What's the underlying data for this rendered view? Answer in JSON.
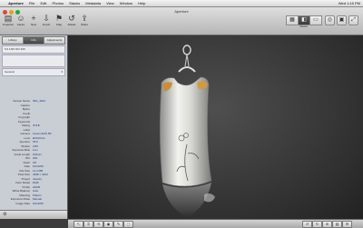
{
  "menubar": {
    "app_name": "Aperture",
    "items": [
      "File",
      "Edit",
      "Photos",
      "Stacks",
      "Metadata",
      "View",
      "Window",
      "Help"
    ],
    "status": [
      "Wed 1:15 PM"
    ]
  },
  "window": {
    "title": "Aperture"
  },
  "toolbar": {
    "buttons": [
      {
        "icon": "inbox-icon",
        "glyph": "▤",
        "label": "Inspector"
      },
      {
        "icon": "person-icon",
        "glyph": "☺",
        "label": "Faces"
      },
      {
        "icon": "plus-icon",
        "glyph": "+",
        "label": "New"
      },
      {
        "icon": "import-icon",
        "glyph": "⇩",
        "label": "Import"
      },
      {
        "icon": "flag-icon",
        "glyph": "⚑",
        "label": "Flag"
      },
      {
        "icon": "rotate-left-icon",
        "glyph": "↺",
        "label": "Rotate"
      },
      {
        "icon": "share-icon",
        "glyph": "⇪",
        "label": "Share"
      }
    ],
    "view_label": "Viewer",
    "right_icons": [
      "loupe-icon",
      "hud-icon",
      "fullscreen-icon"
    ]
  },
  "sidebar": {
    "tabs": [
      {
        "label": "Library",
        "selected": false
      },
      {
        "label": "Info",
        "selected": true
      },
      {
        "label": "Adjustments",
        "selected": false
      }
    ],
    "camera_info": "5.6  1/60  ISO 200",
    "preset": "General",
    "metadata": [
      {
        "k": "Version Name",
        "v": "IMG_3024"
      },
      {
        "k": "Caption",
        "v": ""
      },
      {
        "k": "Byline",
        "v": ""
      },
      {
        "k": "Credit",
        "v": ""
      },
      {
        "k": "Copyright",
        "v": ""
      },
      {
        "k": "Keywords",
        "v": ""
      },
      {
        "k": "Rating",
        "v": "★★★"
      },
      {
        "k": "Label",
        "v": ""
      },
      {
        "k": "Camera",
        "v": "Canon EOS 5D"
      },
      {
        "k": "Lens",
        "v": "EF100mm"
      },
      {
        "k": "Aperture",
        "v": "f/5.6"
      },
      {
        "k": "Shutter",
        "v": "1/60"
      },
      {
        "k": "Exposure Bias",
        "v": "0 ev"
      },
      {
        "k": "Focal Length",
        "v": "100mm"
      },
      {
        "k": "ISO",
        "v": "200"
      },
      {
        "k": "Flash",
        "v": "Off"
      },
      {
        "k": "Date",
        "v": "10/12/09"
      },
      {
        "k": "File Size",
        "v": "12.4 MB"
      },
      {
        "k": "Pixel Size",
        "v": "4368 × 2912"
      },
      {
        "k": "Project",
        "v": "Jewelry"
      },
      {
        "k": "Color Model",
        "v": "RGB"
      },
      {
        "k": "Profile",
        "v": "sRGB"
      },
      {
        "k": "White Balance",
        "v": "Auto"
      },
      {
        "k": "Metering",
        "v": "Pattern"
      },
      {
        "k": "Exposure Mode",
        "v": "Manual"
      },
      {
        "k": "Image Date",
        "v": "10/12/09"
      }
    ]
  },
  "viewer": {
    "subject": "silver-dress-pendant"
  },
  "bottombar": {
    "left_icons": [
      "arrow-tool-icon",
      "crop-tool-icon",
      "straighten-tool-icon",
      "redeye-tool-icon",
      "brush-tool-icon",
      "lift-stamp-icon"
    ],
    "right_icons": [
      "rotate-left-icon",
      "rotate-right-icon",
      "zoom-icon",
      "stack-icon",
      "settings-icon"
    ]
  },
  "colors": {
    "accent": "#3a6fc4",
    "viewer_bg": "#333333"
  }
}
